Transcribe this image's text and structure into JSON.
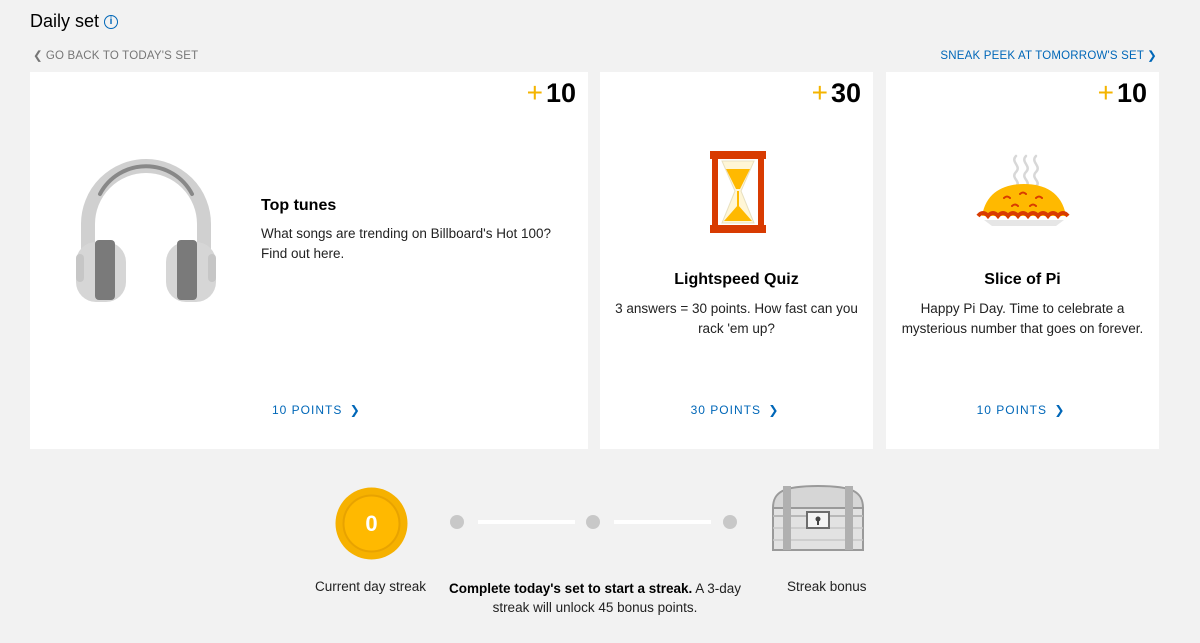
{
  "header": {
    "title": "Daily set",
    "info_glyph": "i",
    "back_link": "GO BACK TO TODAY'S SET",
    "peek_link": "SNEAK PEEK AT TOMORROW'S SET"
  },
  "accent_color": "#0067b8",
  "plus_color": "#f4b400",
  "cards": [
    {
      "icon": "headphones-icon",
      "plus": "+",
      "points": "10",
      "title": "Top tunes",
      "description": "What songs are trending on Billboard's Hot 100? Find out here.",
      "link": "10 POINTS"
    },
    {
      "icon": "hourglass-icon",
      "plus": "+",
      "points": "30",
      "title": "Lightspeed Quiz",
      "description": "3 answers = 30 points. How fast can you rack 'em up?",
      "link": "30 POINTS"
    },
    {
      "icon": "pie-icon",
      "plus": "+",
      "points": "10",
      "title": "Slice of Pi",
      "description": "Happy Pi Day. Time to celebrate a mysterious number that goes on forever.",
      "link": "10 POINTS"
    }
  ],
  "streak": {
    "current_value": "0",
    "current_label": "Current day streak",
    "message_bold": "Complete today's set to start a streak.",
    "message_rest": " A 3-day streak will unlock 45 bonus points.",
    "bonus_label": "Streak bonus",
    "bonus_icon": "treasure-chest-icon"
  }
}
